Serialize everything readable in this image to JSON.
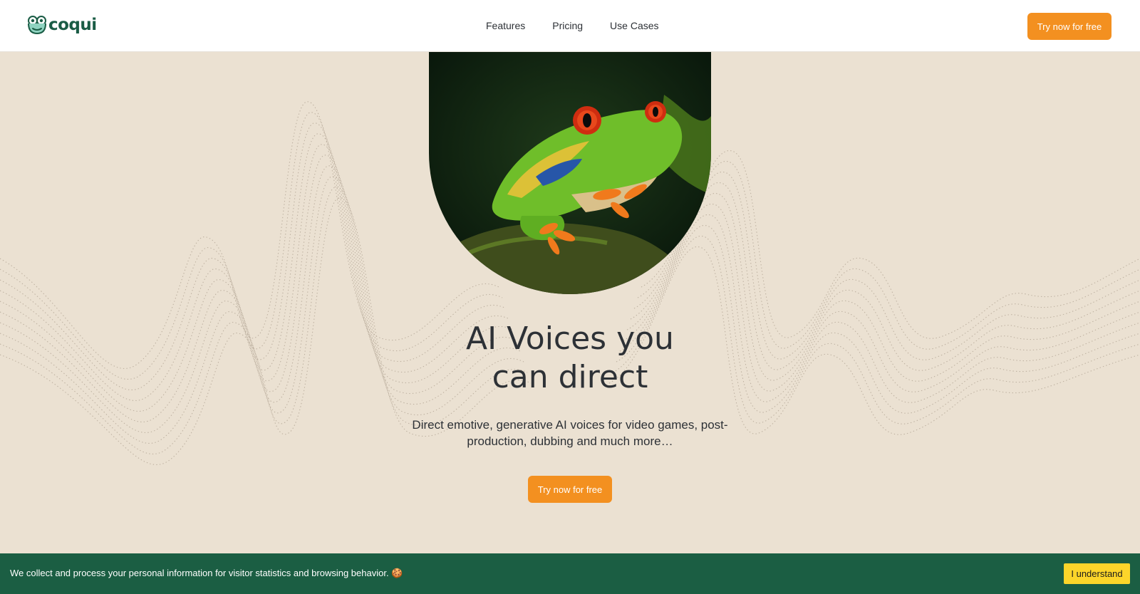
{
  "header": {
    "logo_text": "coqui",
    "nav": [
      {
        "label": "Features"
      },
      {
        "label": "Pricing"
      },
      {
        "label": "Use Cases"
      }
    ],
    "cta_label": "Try now for free"
  },
  "hero": {
    "title_line1": "AI Voices you",
    "title_line2": "can direct",
    "subtitle": "Direct emotive, generative AI voices for video games, post-production, dubbing and much more…",
    "cta_label": "Try now for free",
    "image_subject": "red-eyed-tree-frog"
  },
  "cookie_banner": {
    "text": "We collect and process your personal information for visitor statistics and browsing behavior. 🍪",
    "button_label": "I understand"
  },
  "colors": {
    "accent_orange": "#f39020",
    "brand_green": "#1b5e43",
    "hero_background": "#ebe1d2",
    "cookie_button": "#fcd52a"
  }
}
